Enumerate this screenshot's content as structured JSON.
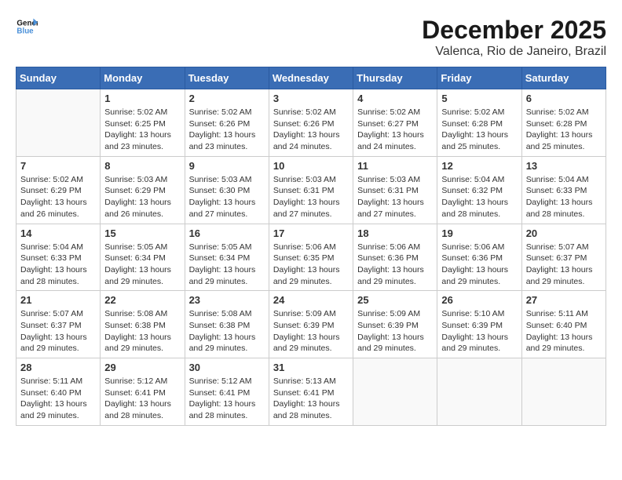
{
  "logo": {
    "line1": "General",
    "line2": "Blue"
  },
  "title": "December 2025",
  "location": "Valenca, Rio de Janeiro, Brazil",
  "days_of_week": [
    "Sunday",
    "Monday",
    "Tuesday",
    "Wednesday",
    "Thursday",
    "Friday",
    "Saturday"
  ],
  "weeks": [
    [
      {
        "day": "",
        "info": ""
      },
      {
        "day": "1",
        "info": "Sunrise: 5:02 AM\nSunset: 6:25 PM\nDaylight: 13 hours\nand 23 minutes."
      },
      {
        "day": "2",
        "info": "Sunrise: 5:02 AM\nSunset: 6:26 PM\nDaylight: 13 hours\nand 23 minutes."
      },
      {
        "day": "3",
        "info": "Sunrise: 5:02 AM\nSunset: 6:26 PM\nDaylight: 13 hours\nand 24 minutes."
      },
      {
        "day": "4",
        "info": "Sunrise: 5:02 AM\nSunset: 6:27 PM\nDaylight: 13 hours\nand 24 minutes."
      },
      {
        "day": "5",
        "info": "Sunrise: 5:02 AM\nSunset: 6:28 PM\nDaylight: 13 hours\nand 25 minutes."
      },
      {
        "day": "6",
        "info": "Sunrise: 5:02 AM\nSunset: 6:28 PM\nDaylight: 13 hours\nand 25 minutes."
      }
    ],
    [
      {
        "day": "7",
        "info": "Sunrise: 5:02 AM\nSunset: 6:29 PM\nDaylight: 13 hours\nand 26 minutes."
      },
      {
        "day": "8",
        "info": "Sunrise: 5:03 AM\nSunset: 6:29 PM\nDaylight: 13 hours\nand 26 minutes."
      },
      {
        "day": "9",
        "info": "Sunrise: 5:03 AM\nSunset: 6:30 PM\nDaylight: 13 hours\nand 27 minutes."
      },
      {
        "day": "10",
        "info": "Sunrise: 5:03 AM\nSunset: 6:31 PM\nDaylight: 13 hours\nand 27 minutes."
      },
      {
        "day": "11",
        "info": "Sunrise: 5:03 AM\nSunset: 6:31 PM\nDaylight: 13 hours\nand 27 minutes."
      },
      {
        "day": "12",
        "info": "Sunrise: 5:04 AM\nSunset: 6:32 PM\nDaylight: 13 hours\nand 28 minutes."
      },
      {
        "day": "13",
        "info": "Sunrise: 5:04 AM\nSunset: 6:33 PM\nDaylight: 13 hours\nand 28 minutes."
      }
    ],
    [
      {
        "day": "14",
        "info": "Sunrise: 5:04 AM\nSunset: 6:33 PM\nDaylight: 13 hours\nand 28 minutes."
      },
      {
        "day": "15",
        "info": "Sunrise: 5:05 AM\nSunset: 6:34 PM\nDaylight: 13 hours\nand 29 minutes."
      },
      {
        "day": "16",
        "info": "Sunrise: 5:05 AM\nSunset: 6:34 PM\nDaylight: 13 hours\nand 29 minutes."
      },
      {
        "day": "17",
        "info": "Sunrise: 5:06 AM\nSunset: 6:35 PM\nDaylight: 13 hours\nand 29 minutes."
      },
      {
        "day": "18",
        "info": "Sunrise: 5:06 AM\nSunset: 6:36 PM\nDaylight: 13 hours\nand 29 minutes."
      },
      {
        "day": "19",
        "info": "Sunrise: 5:06 AM\nSunset: 6:36 PM\nDaylight: 13 hours\nand 29 minutes."
      },
      {
        "day": "20",
        "info": "Sunrise: 5:07 AM\nSunset: 6:37 PM\nDaylight: 13 hours\nand 29 minutes."
      }
    ],
    [
      {
        "day": "21",
        "info": "Sunrise: 5:07 AM\nSunset: 6:37 PM\nDaylight: 13 hours\nand 29 minutes."
      },
      {
        "day": "22",
        "info": "Sunrise: 5:08 AM\nSunset: 6:38 PM\nDaylight: 13 hours\nand 29 minutes."
      },
      {
        "day": "23",
        "info": "Sunrise: 5:08 AM\nSunset: 6:38 PM\nDaylight: 13 hours\nand 29 minutes."
      },
      {
        "day": "24",
        "info": "Sunrise: 5:09 AM\nSunset: 6:39 PM\nDaylight: 13 hours\nand 29 minutes."
      },
      {
        "day": "25",
        "info": "Sunrise: 5:09 AM\nSunset: 6:39 PM\nDaylight: 13 hours\nand 29 minutes."
      },
      {
        "day": "26",
        "info": "Sunrise: 5:10 AM\nSunset: 6:39 PM\nDaylight: 13 hours\nand 29 minutes."
      },
      {
        "day": "27",
        "info": "Sunrise: 5:11 AM\nSunset: 6:40 PM\nDaylight: 13 hours\nand 29 minutes."
      }
    ],
    [
      {
        "day": "28",
        "info": "Sunrise: 5:11 AM\nSunset: 6:40 PM\nDaylight: 13 hours\nand 29 minutes."
      },
      {
        "day": "29",
        "info": "Sunrise: 5:12 AM\nSunset: 6:41 PM\nDaylight: 13 hours\nand 28 minutes."
      },
      {
        "day": "30",
        "info": "Sunrise: 5:12 AM\nSunset: 6:41 PM\nDaylight: 13 hours\nand 28 minutes."
      },
      {
        "day": "31",
        "info": "Sunrise: 5:13 AM\nSunset: 6:41 PM\nDaylight: 13 hours\nand 28 minutes."
      },
      {
        "day": "",
        "info": ""
      },
      {
        "day": "",
        "info": ""
      },
      {
        "day": "",
        "info": ""
      }
    ]
  ]
}
